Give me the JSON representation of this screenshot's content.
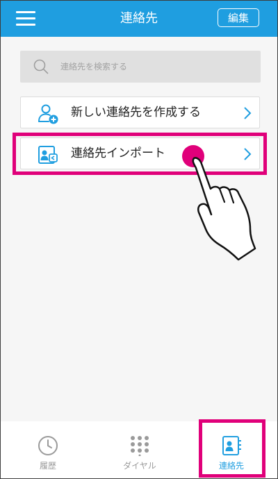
{
  "header": {
    "title": "連絡先",
    "edit_label": "編集"
  },
  "search": {
    "placeholder": "連絡先を検索する"
  },
  "list": {
    "items": [
      {
        "label": "新しい連絡先を作成する",
        "icon": "add-person-icon"
      },
      {
        "label": "連絡先インポート",
        "icon": "import-contacts-icon"
      }
    ]
  },
  "tabbar": {
    "tabs": [
      {
        "label": "履歴",
        "icon": "clock-icon"
      },
      {
        "label": "ダイヤル",
        "icon": "dialpad-icon"
      },
      {
        "label": "連絡先",
        "icon": "contacts-icon",
        "active": true
      }
    ]
  },
  "colors": {
    "accent": "#1f9ee0",
    "highlight": "#e0007a",
    "background": "#f6f6f6"
  }
}
